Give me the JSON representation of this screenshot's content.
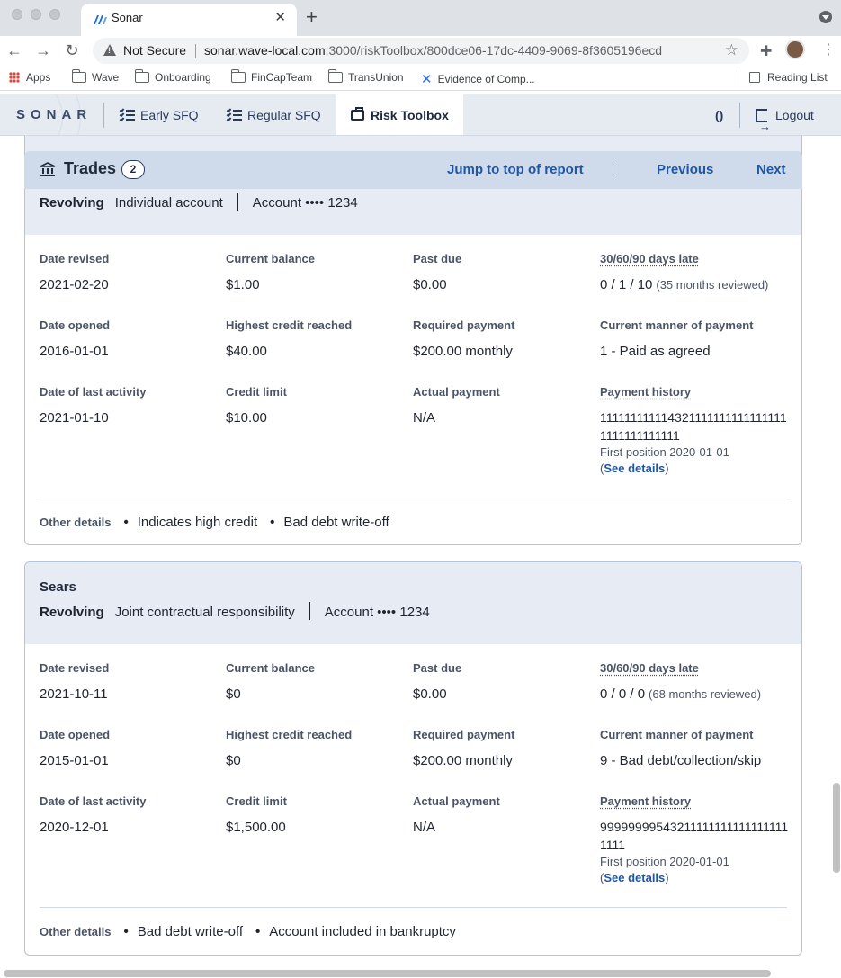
{
  "browser": {
    "tab_title": "Sonar",
    "tab_close": "✕",
    "new_tab": "+",
    "back": "←",
    "forward": "→",
    "reload": "↻",
    "security_label": "Not Secure",
    "url_host": "sonar.wave-local.com",
    "url_path": ":3000/riskToolbox/800dce06-17dc-4409-9069-8f3605196ecd",
    "bookmarks": [
      "Apps",
      "Wave",
      "Onboarding",
      "FinCapTeam",
      "TransUnion",
      "Evidence of Comp..."
    ],
    "reading_list": "Reading List"
  },
  "nav": {
    "logo": "SONAR",
    "items": [
      "Early SFQ",
      "Regular SFQ",
      "Risk Toolbox"
    ],
    "active": "Risk Toolbox",
    "parens": "()",
    "logout": "Logout"
  },
  "section": {
    "title": "Trades",
    "count": "2",
    "jump_link": "Jump to top of report",
    "previous": "Previous",
    "next": "Next"
  },
  "labels": {
    "date_revised": "Date revised",
    "current_balance": "Current balance",
    "past_due": "Past due",
    "days_late": "30/60/90 days late",
    "date_opened": "Date opened",
    "highest_credit": "Highest credit reached",
    "required_payment": "Required payment",
    "manner_of_payment": "Current manner of payment",
    "date_last_activity": "Date of last activity",
    "credit_limit": "Credit limit",
    "actual_payment": "Actual payment",
    "payment_history": "Payment history",
    "other_details": "Other details",
    "see_details": "See details",
    "account_prefix": "Account"
  },
  "trades": [
    {
      "creditor": "",
      "type": "Revolving",
      "ownership": "Individual account",
      "account_mask": "•••• 1234",
      "date_revised": "2021-02-20",
      "current_balance": "$1.00",
      "past_due": "$0.00",
      "days_late": "0 / 1 / 10",
      "months_reviewed": "(35 months reviewed)",
      "date_opened": "2016-01-01",
      "highest_credit": "$40.00",
      "required_payment": "$200.00 monthly",
      "manner_of_payment": "1 - Paid as agreed",
      "date_last_activity": "2021-01-10",
      "credit_limit": "$10.00",
      "actual_payment": "N/A",
      "payment_history": "1111111111143211111111111111111111111111111",
      "first_position": "First position 2020-01-01",
      "other_details": [
        "Indicates high credit",
        "Bad debt write-off"
      ]
    },
    {
      "creditor": "Sears",
      "type": "Revolving",
      "ownership": "Joint contractual responsibility",
      "account_mask": "•••• 1234",
      "date_revised": "2021-10-11",
      "current_balance": "$0",
      "past_due": "$0.00",
      "days_late": "0 / 0 / 0",
      "months_reviewed": "(68 months reviewed)",
      "date_opened": "2015-01-01",
      "highest_credit": "$0",
      "required_payment": "$200.00 monthly",
      "manner_of_payment": "9 - Bad debt/collection/skip",
      "date_last_activity": "2020-12-01",
      "credit_limit": "$1,500.00",
      "actual_payment": "N/A",
      "payment_history": "999999995432111111111111111111111",
      "first_position": "First position 2020-01-01",
      "other_details": [
        "Bad debt write-off",
        "Account included in bankruptcy"
      ]
    }
  ]
}
